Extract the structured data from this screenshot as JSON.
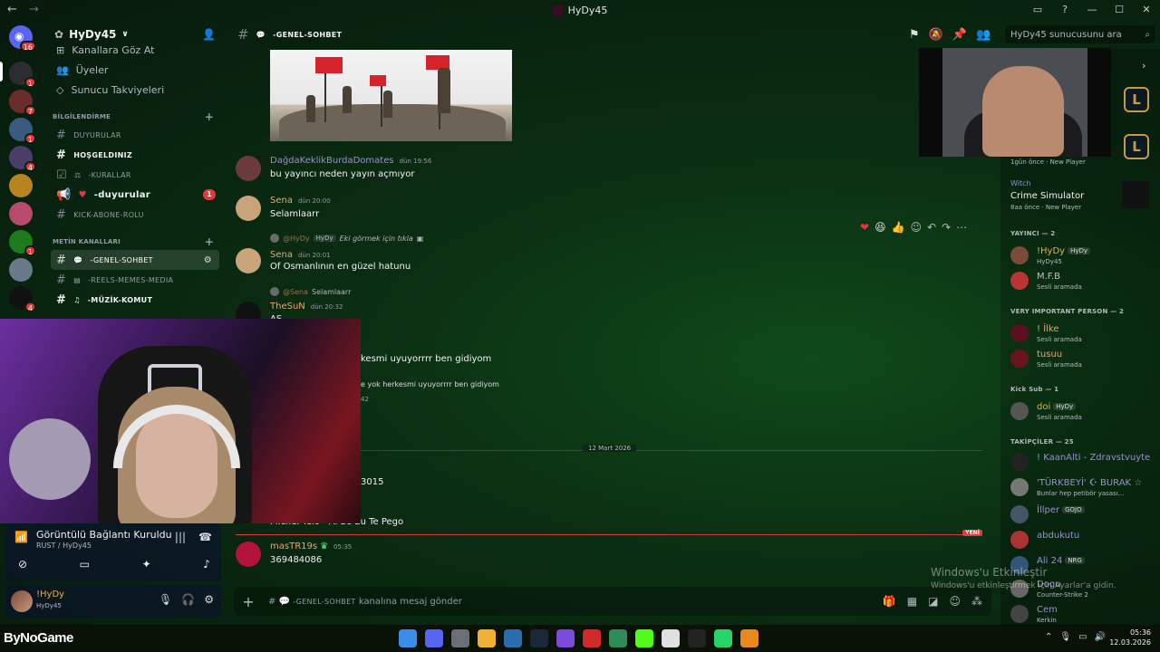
{
  "window": {
    "title": "HyDy45",
    "controls": [
      "▭",
      "?",
      "—",
      "☐",
      "✕"
    ]
  },
  "rail": {
    "home_badge": "16",
    "servers": [
      {
        "color": "#2b2d31",
        "badge": "1"
      },
      {
        "color": "#6b2c2c",
        "badge": "7"
      },
      {
        "color": "#3a5a80",
        "badge": "1"
      },
      {
        "color": "#4a3d6a",
        "badge": "4"
      },
      {
        "color": "#b8841f",
        "badge": ""
      },
      {
        "color": "#b84a6b",
        "badge": ""
      },
      {
        "color": "#1d7a1d",
        "badge": "1"
      },
      {
        "color": "#6a7a8a",
        "badge": ""
      },
      {
        "color": "#111111",
        "badge": "4"
      }
    ]
  },
  "sidebar": {
    "server_name": "HyDy45",
    "top_items": [
      "Kanallara Göz At",
      "Üyeler",
      "Sunucu Takviyeleri"
    ],
    "categories": [
      {
        "name": "BİLGİLENDİRME",
        "channels": [
          {
            "name": "DUYURULAR"
          },
          {
            "name": "HOŞGELDINIZ"
          },
          {
            "name": "-KURALLAR"
          },
          {
            "name": "-duyurular",
            "count": "1"
          },
          {
            "name": "KICK-ABONE-ROLU"
          }
        ]
      },
      {
        "name": "METİN KANALLARI",
        "channels": [
          {
            "name": "-GENEL-SOHBET"
          },
          {
            "name": "-REELS-MEMES-MEDIA"
          },
          {
            "name": "-MÜZİK-KOMUT"
          }
        ]
      }
    ]
  },
  "chat": {
    "channel": "-GENEL-SOHBET",
    "search_placeholder": "HyDy45 sunucusunu ara",
    "messages": [
      {
        "user": "DağdaKeklikBurdaDomates",
        "time": "dün 19:56",
        "text": "bu yayıncı neden yayın açmıyor",
        "color": "#9b8fd6"
      },
      {
        "user": "Sena",
        "time": "dün 20:00",
        "text": "Selamlaarr",
        "color": "#f0a36b"
      },
      {
        "user": "Sena",
        "time": "dün 20:01",
        "text": "Of Osmanlının en güzel hatunu",
        "color": "#f0a36b",
        "reply": {
          "user": "@HyDy",
          "tag": "HyDy",
          "text": "Eki görmek için tıkla"
        }
      },
      {
        "user": "TheSuN",
        "time": "dün 20:32",
        "text": "AS",
        "color": "#f0a36b",
        "reply": {
          "user": "@Sena",
          "text": "Selamlaarr"
        }
      },
      {
        "text": "kesmi uyuyorrrr  ben gidiyom"
      },
      {
        "text": "e yok herkesmi uyuyorrrr  ben gidiyom",
        "time": "42"
      },
      {
        "text": "3015"
      },
      {
        "text": "Michel Telo - Ai Se Eu Te Pego"
      },
      {
        "user": "masTR19s",
        "time": "05:35",
        "text": "369484086",
        "color": "#f0a36b"
      }
    ],
    "date_separator": "12 Mart 2026",
    "new_label": "YENİ",
    "composer_placeholder": "kanalına mesaj gönder",
    "reactions": [
      "❤",
      "😆",
      "👍"
    ]
  },
  "members": {
    "activities": [
      {
        "when": "1gün önce",
        "badge": "New Player"
      },
      {
        "name": "Witch",
        "game": "Crime Simulator",
        "when": "8aa önce",
        "badge": "New Player"
      }
    ],
    "groups": [
      {
        "title": "YAYINCI — 2",
        "items": [
          {
            "name": "!HyDy",
            "tag": "HyDy",
            "status": "HyDy45",
            "color": "#f0b132"
          },
          {
            "name": "M.F.B",
            "status": "Sesli aramada",
            "color": "#c0c0c0"
          }
        ]
      },
      {
        "title": "VERY IMPORTANT PERSON — 2",
        "items": [
          {
            "name": "! İlke",
            "status": "Sesli aramada",
            "color": "#f0a36b"
          },
          {
            "name": "tusuu",
            "status": "Sesli aramada",
            "color": "#f0a36b"
          }
        ]
      },
      {
        "title": "Kick Sub — 1",
        "items": [
          {
            "name": "doi",
            "tag": "HyDy",
            "status": "Sesli aramada",
            "color": "#f0b132"
          }
        ]
      },
      {
        "title": "TAKİPÇİLER — 25",
        "items": [
          {
            "name": "! KaanAlti - Zdravstvuyte",
            "status": "",
            "color": "#9b8fd6"
          },
          {
            "name": "'TÜRKBEYİ' ☪ BURAK ☆",
            "status": "Bunlar hep petibör yasası...",
            "color": "#9b8fd6"
          },
          {
            "name": "İllper",
            "tag": "GOJO",
            "status": "",
            "color": "#9b8fd6"
          },
          {
            "name": "abdukutu",
            "status": "",
            "color": "#9b8fd6"
          },
          {
            "name": "Ali 24",
            "tag": "NRG",
            "status": "",
            "color": "#9b8fd6"
          },
          {
            "name": "Dogu",
            "status": "Counter-Strike 2",
            "color": "#9b8fd6"
          },
          {
            "name": "Cem",
            "status": "Kerkin",
            "color": "#9b8fd6"
          }
        ]
      }
    ]
  },
  "voice": {
    "status": "Görüntülü Bağlantı Kuruldu",
    "location": "RUST / HyDy45"
  },
  "user": {
    "name": "!HyDy",
    "status": "HyDy45"
  },
  "watermark": {
    "line1": "Windows'u Etkinleştir",
    "line2": "Windows'u etkinleştirmek için Ayarlar'a gidin."
  },
  "brand": "ByNoGame",
  "clock": {
    "time": "05:36",
    "date": "12.03.2026"
  }
}
